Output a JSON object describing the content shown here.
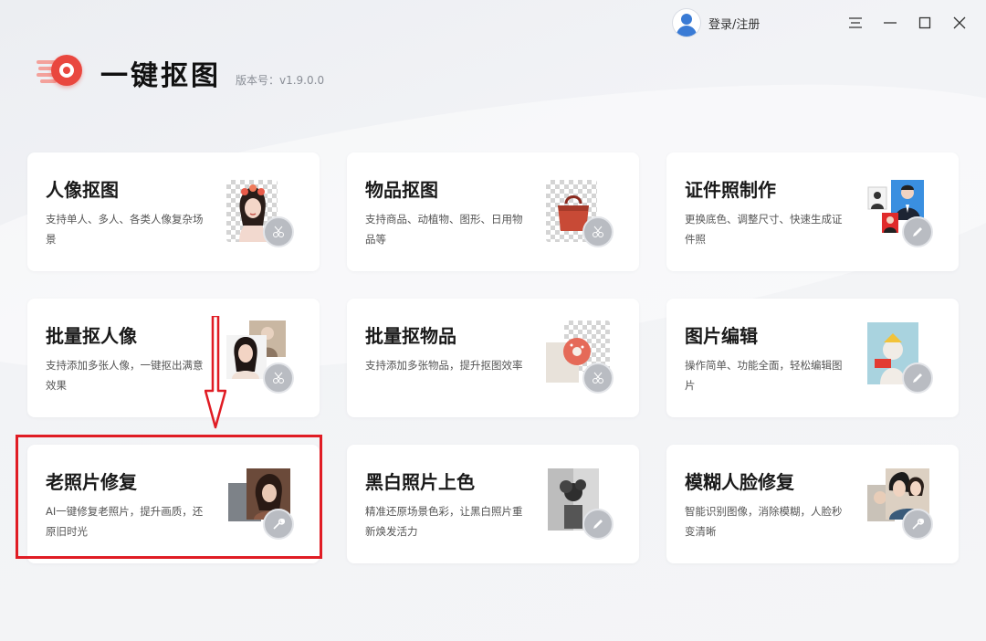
{
  "header": {
    "login_label": "登录/注册",
    "app_name": "一键抠图",
    "version": "版本号：v1.9.0.0"
  },
  "window_controls": [
    "menu-icon",
    "minimize-icon",
    "maximize-icon",
    "close-icon"
  ],
  "colors": {
    "brand": "#e9473f",
    "highlight": "#e01c24",
    "badge": "#b9bcc2"
  },
  "cards": [
    {
      "title": "人像抠图",
      "desc": "支持单人、多人、各类人像复杂场景",
      "badge_icon": "scissors-icon"
    },
    {
      "title": "物品抠图",
      "desc": "支持商品、动植物、图形、日用物品等",
      "badge_icon": "scissors-icon"
    },
    {
      "title": "证件照制作",
      "desc": "更换底色、调整尺寸、快速生成证件照",
      "badge_icon": "pencil-icon"
    },
    {
      "title": "批量抠人像",
      "desc": "支持添加多张人像，一键抠出满意效果",
      "badge_icon": "scissors-icon"
    },
    {
      "title": "批量抠物品",
      "desc": "支持添加多张物品，提升抠图效率",
      "badge_icon": "scissors-icon"
    },
    {
      "title": "图片编辑",
      "desc": "操作简单、功能全面，轻松编辑图片",
      "badge_icon": "pencil-icon"
    },
    {
      "title": "老照片修复",
      "desc": "AI一键修复老照片，提升画质，还原旧时光",
      "badge_icon": "wrench-icon"
    },
    {
      "title": "黑白照片上色",
      "desc": "精准还原场景色彩，让黑白照片重新焕发活力",
      "badge_icon": "pencil-icon"
    },
    {
      "title": "模糊人脸修复",
      "desc": "智能识别图像，消除模糊，人脸秒变清晰",
      "badge_icon": "wrench-icon"
    }
  ]
}
